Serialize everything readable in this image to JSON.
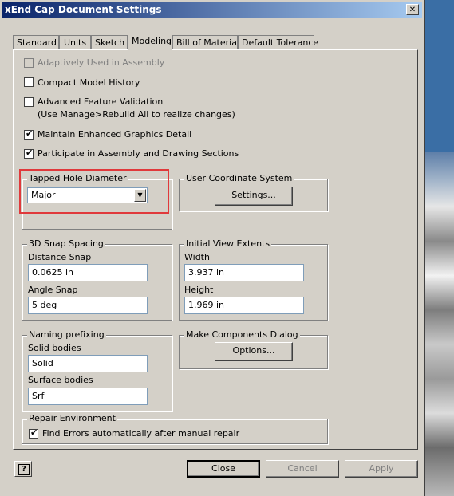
{
  "window": {
    "title": "xEnd Cap Document Settings",
    "close_glyph": "✕"
  },
  "tabs": [
    {
      "label": "Standard",
      "active": false
    },
    {
      "label": "Units",
      "active": false
    },
    {
      "label": "Sketch",
      "active": false
    },
    {
      "label": "Modeling",
      "active": true
    },
    {
      "label": "Bill of Materials",
      "active": false
    },
    {
      "label": "Default Tolerance",
      "active": false
    }
  ],
  "options": {
    "adaptively_used": {
      "label": "Adaptively Used in Assembly",
      "checked": false,
      "enabled": false
    },
    "compact_history": {
      "label": "Compact Model History",
      "checked": false
    },
    "advanced_validation": {
      "label": "Advanced Feature Validation",
      "note": "(Use Manage>Rebuild All to realize changes)",
      "checked": false
    },
    "enhanced_graphics": {
      "label": "Maintain Enhanced Graphics Detail",
      "checked": true
    },
    "participate_sections": {
      "label": "Participate in Assembly and Drawing Sections",
      "checked": true
    }
  },
  "tapped_hole": {
    "title": "Tapped Hole Diameter",
    "selected": "Major",
    "highlight_color": "#e0393b"
  },
  "ucs": {
    "title": "User Coordinate System",
    "button": "Settings..."
  },
  "snap": {
    "title": "3D Snap Spacing",
    "distance_label": "Distance Snap",
    "distance_value": "0.0625 in",
    "angle_label": "Angle Snap",
    "angle_value": "5 deg"
  },
  "view_extents": {
    "title": "Initial View Extents",
    "width_label": "Width",
    "width_value": "3.937 in",
    "height_label": "Height",
    "height_value": "1.969 in"
  },
  "naming": {
    "title": "Naming prefixing",
    "solid_label": "Solid bodies",
    "solid_value": "Solid",
    "surface_label": "Surface bodies",
    "surface_value": "Srf"
  },
  "components_dialog": {
    "title": "Make Components Dialog",
    "button": "Options..."
  },
  "repair": {
    "title": "Repair Environment",
    "find_errors_label": "Find Errors automatically after manual repair",
    "checked": true
  },
  "footer": {
    "help_glyph": "?",
    "close": "Close",
    "cancel": "Cancel",
    "apply": "Apply"
  },
  "check_glyph": "✔",
  "dropdown_glyph": "▼"
}
